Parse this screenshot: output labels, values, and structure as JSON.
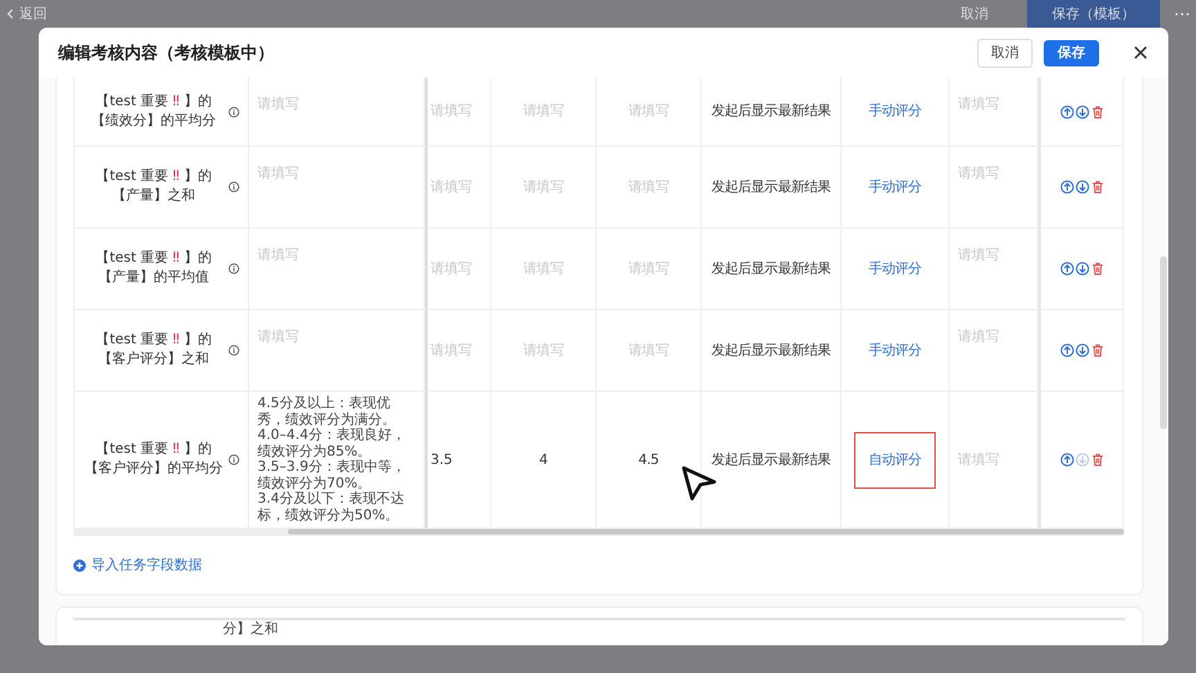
{
  "backdrop": {
    "back_label": "返回",
    "cancel_label": "取消",
    "save_label": "保存（模板）",
    "more_label": "⋯"
  },
  "dialog": {
    "title": "编辑考核内容（考核模板中）",
    "cancel_label": "取消",
    "save_label": "保存"
  },
  "table": {
    "rows": [
      {
        "name": {
          "before": "【test 重要 ",
          "mark": "‼",
          "after": " 】的【绩效分】的平均分"
        },
        "standard": {
          "placeholder": "请填写"
        },
        "column_3": {
          "placeholder": "请填写"
        },
        "column_4": {
          "placeholder": "请填写"
        },
        "column_5": {
          "placeholder": "请填写"
        },
        "result": "发起后显示最新结果",
        "mode": {
          "label": "手动评分",
          "highlighted": false
        },
        "column_8": {
          "placeholder": "请填写"
        },
        "actions": {
          "down_disabled": false
        }
      },
      {
        "name": {
          "before": "【test 重要 ",
          "mark": "‼",
          "after": " 】的【产量】之和"
        },
        "standard": {
          "placeholder": "请填写"
        },
        "column_3": {
          "placeholder": "请填写"
        },
        "column_4": {
          "placeholder": "请填写"
        },
        "column_5": {
          "placeholder": "请填写"
        },
        "result": "发起后显示最新结果",
        "mode": {
          "label": "手动评分",
          "highlighted": false
        },
        "column_8": {
          "placeholder": "请填写"
        },
        "actions": {
          "down_disabled": false
        }
      },
      {
        "name": {
          "before": "【test 重要 ",
          "mark": "‼",
          "after": " 】的【产量】的平均值"
        },
        "standard": {
          "placeholder": "请填写"
        },
        "column_3": {
          "placeholder": "请填写"
        },
        "column_4": {
          "placeholder": "请填写"
        },
        "column_5": {
          "placeholder": "请填写"
        },
        "result": "发起后显示最新结果",
        "mode": {
          "label": "手动评分",
          "highlighted": false
        },
        "column_8": {
          "placeholder": "请填写"
        },
        "actions": {
          "down_disabled": false
        }
      },
      {
        "name": {
          "before": "【test 重要 ",
          "mark": "‼",
          "after": " 】的【客户评分】之和"
        },
        "standard": {
          "placeholder": "请填写"
        },
        "column_3": {
          "placeholder": "请填写"
        },
        "column_4": {
          "placeholder": "请填写"
        },
        "column_5": {
          "placeholder": "请填写"
        },
        "result": "发起后显示最新结果",
        "mode": {
          "label": "手动评分",
          "highlighted": false
        },
        "column_8": {
          "placeholder": "请填写"
        },
        "actions": {
          "down_disabled": false
        }
      },
      {
        "name": {
          "before": "【test 重要 ",
          "mark": "‼",
          "after": " 】的【客户评分】的平均分"
        },
        "standard": {
          "value": "4.5分及以上：表现优秀，绩效评分为满分。\n4.0–4.4分：表现良好，绩效评分为85%。\n3.5–3.9分：表现中等，绩效评分为70%。\n3.4分及以下：表现不达标，绩效评分为50%。"
        },
        "column_3": {
          "value": "3.5"
        },
        "column_4": {
          "value": "4"
        },
        "column_5": {
          "value": "4.5"
        },
        "result": "发起后显示最新结果",
        "mode": {
          "label": "自动评分",
          "highlighted": true
        },
        "column_8": {
          "placeholder": "请填写"
        },
        "actions": {
          "down_disabled": true
        }
      }
    ]
  },
  "import_link": "导入任务字段数据",
  "second_card": {
    "row_text": "分】之和"
  }
}
